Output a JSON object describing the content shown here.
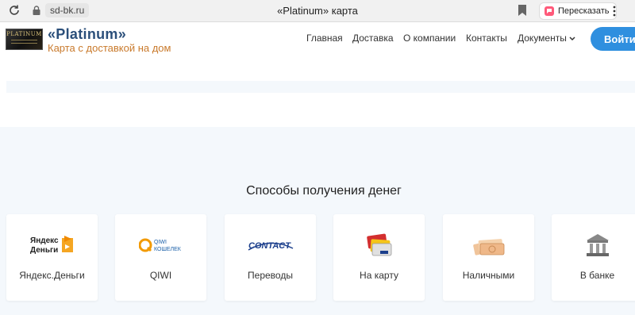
{
  "browser": {
    "url": "sd-bk.ru",
    "tab_title": "«Platinum» карта",
    "retell_label": "Пересказать"
  },
  "header": {
    "logo_text": "PLATINUM",
    "title": "«Platinum»",
    "subtitle": "Карта с доставкой на дом",
    "nav": {
      "home": "Главная",
      "delivery": "Доставка",
      "about": "О компании",
      "contacts": "Контакты",
      "documents": "Документы"
    },
    "login_label": "Войти"
  },
  "section": {
    "title": "Способы получения денег",
    "methods": [
      {
        "label": "Яндекс.Деньги",
        "icon": "yandex-money-icon",
        "icon_text": "Яндекс\nДеньги"
      },
      {
        "label": "QIWI",
        "icon": "qiwi-icon",
        "icon_text": "QIWI\nКОШЕЛЕК"
      },
      {
        "label": "Переводы",
        "icon": "contact-icon",
        "icon_text": "CONTACT"
      },
      {
        "label": "На карту",
        "icon": "bank-cards-icon"
      },
      {
        "label": "Наличными",
        "icon": "cash-icon"
      },
      {
        "label": "В банке",
        "icon": "bank-building-icon"
      }
    ]
  },
  "colors": {
    "accent": "#2f8fdf",
    "brand_title": "#2b4f7a",
    "brand_subtitle": "#c97a2c",
    "page_bg": "#f4f8fc"
  }
}
